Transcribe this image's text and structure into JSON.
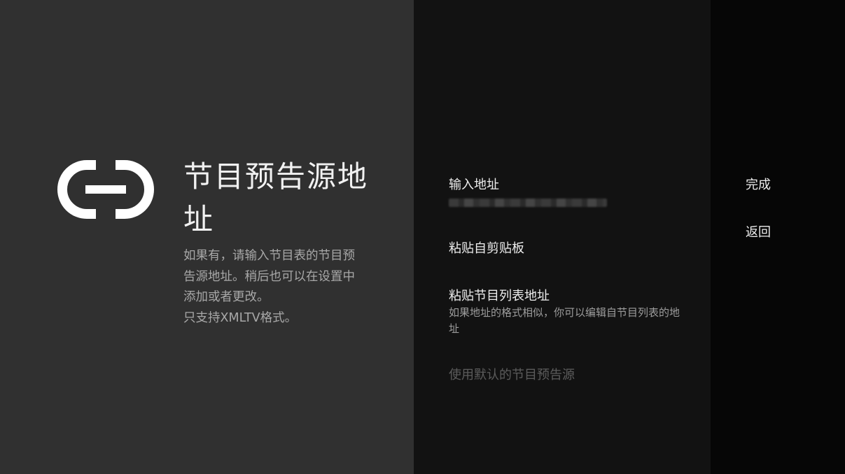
{
  "title": "节目预告源地址",
  "description": [
    "如果有，请输入节目表的节目预告源地址。稍后也可以在设置中添加或者更改。",
    "只支持XMLTV格式。"
  ],
  "options": [
    {
      "label": "输入地址"
    },
    {
      "label": "粘贴自剪贴板"
    },
    {
      "label": "粘贴节目列表地址",
      "sublabel": "如果地址的格式相似，你可以编辑自节目列表的地址"
    },
    {
      "label": "使用默认的节目预告源",
      "disabled": true
    }
  ],
  "actions": {
    "done": "完成",
    "back": "返回"
  },
  "icons": {
    "header": "link-icon"
  },
  "colors": {
    "left_panel": "#303030",
    "middle_panel": "#121212",
    "right_panel": "#060606"
  }
}
